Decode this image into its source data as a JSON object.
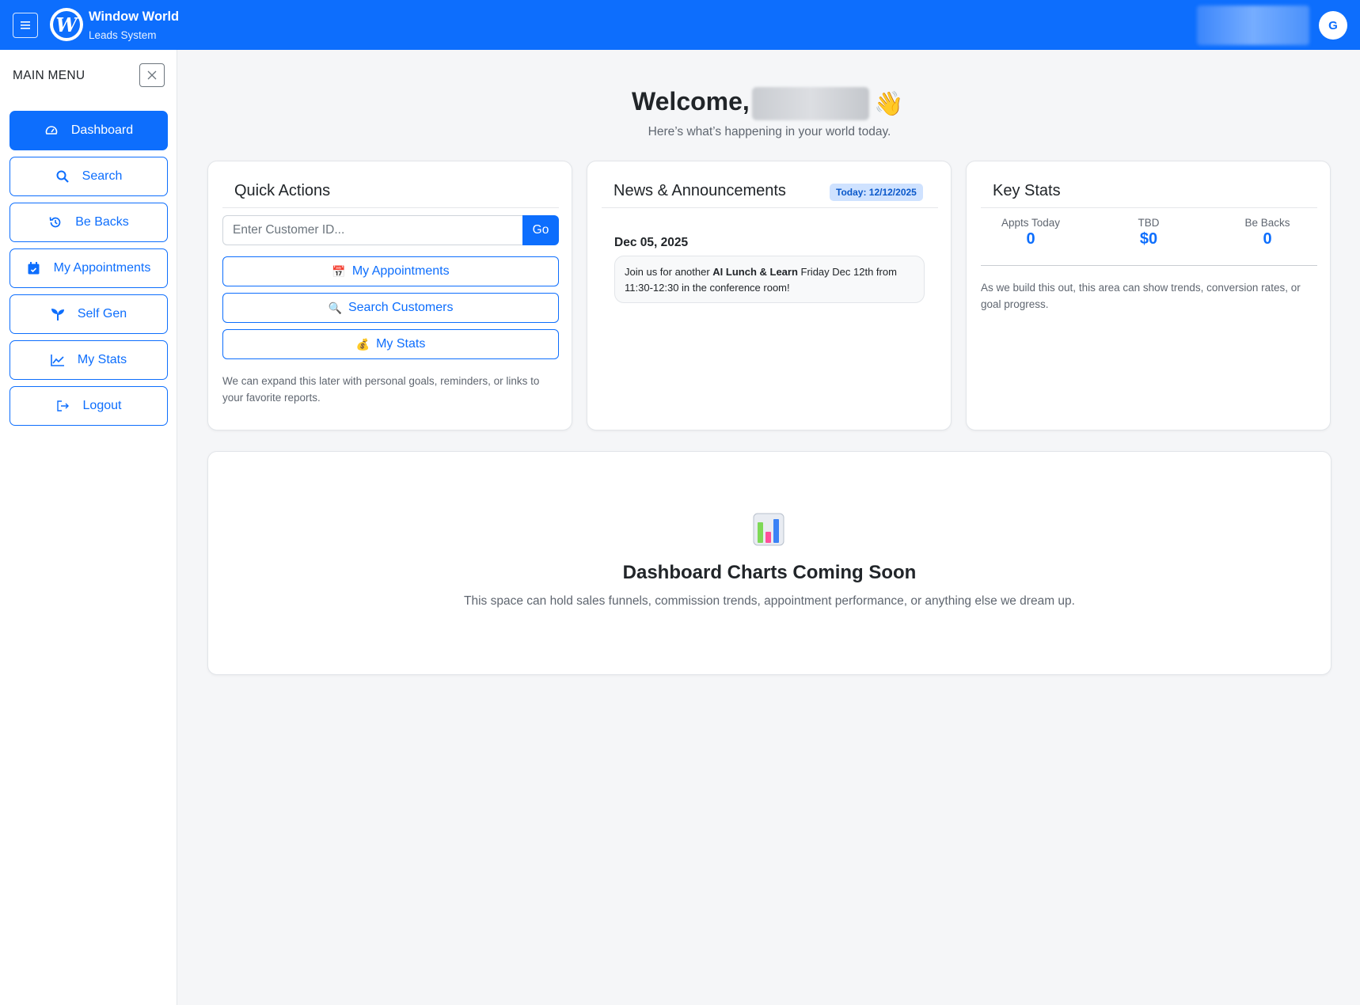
{
  "header": {
    "menu_icon": "hamburger-icon",
    "logo_letter": "W",
    "brand_title": "Window World",
    "brand_subtitle": "Leads System",
    "avatar_initial": "G",
    "accent_color": "#0d6efd"
  },
  "sidebar": {
    "title": "MAIN MENU",
    "close_icon": "close-icon",
    "items": [
      {
        "label": "Dashboard",
        "icon": "gauge-icon",
        "active": true
      },
      {
        "label": "Search",
        "icon": "search-icon",
        "active": false
      },
      {
        "label": "Be Backs",
        "icon": "history-icon",
        "active": false
      },
      {
        "label": "My Appointments",
        "icon": "calendar-icon",
        "active": false
      },
      {
        "label": "Self Gen",
        "icon": "sprout-icon",
        "active": false
      },
      {
        "label": "My Stats",
        "icon": "line-chart-icon",
        "active": false
      },
      {
        "label": "Logout",
        "icon": "logout-icon",
        "active": false
      }
    ]
  },
  "welcome": {
    "greeting": "Welcome,",
    "wave_emoji": "👋",
    "subtitle": "Here’s what’s happening in your world today."
  },
  "quick_actions": {
    "title": "Quick Actions",
    "input_placeholder": "Enter Customer ID...",
    "go_label": "Go",
    "buttons": [
      {
        "emoji": "📅",
        "label": "My Appointments"
      },
      {
        "emoji": "🔍",
        "label": "Search Customers"
      },
      {
        "emoji": "💰",
        "label": "My Stats"
      }
    ],
    "note": "We can expand this later with personal goals, reminders, or links to your favorite reports."
  },
  "news": {
    "title": "News & Announcements",
    "today_badge": "Today: 12/12/2025",
    "items": [
      {
        "date": "Dec 05, 2025",
        "text_before": "Join us for another ",
        "text_bold": "AI Lunch & Learn",
        "text_after": " Friday Dec 12th from 11:30-12:30 in the conference room!"
      }
    ]
  },
  "key_stats": {
    "title": "Key Stats",
    "stats": [
      {
        "label": "Appts Today",
        "value": "0"
      },
      {
        "label": "TBD",
        "value": "$0"
      },
      {
        "label": "Be Backs",
        "value": "0"
      }
    ],
    "note": "As we build this out, this area can show trends, conversion rates, or goal progress."
  },
  "charts_placeholder": {
    "icon": "bar-chart-icon",
    "title": "Dashboard Charts Coming Soon",
    "description": "This space can hold sales funnels, commission trends, appointment performance, or anything else we dream up."
  }
}
